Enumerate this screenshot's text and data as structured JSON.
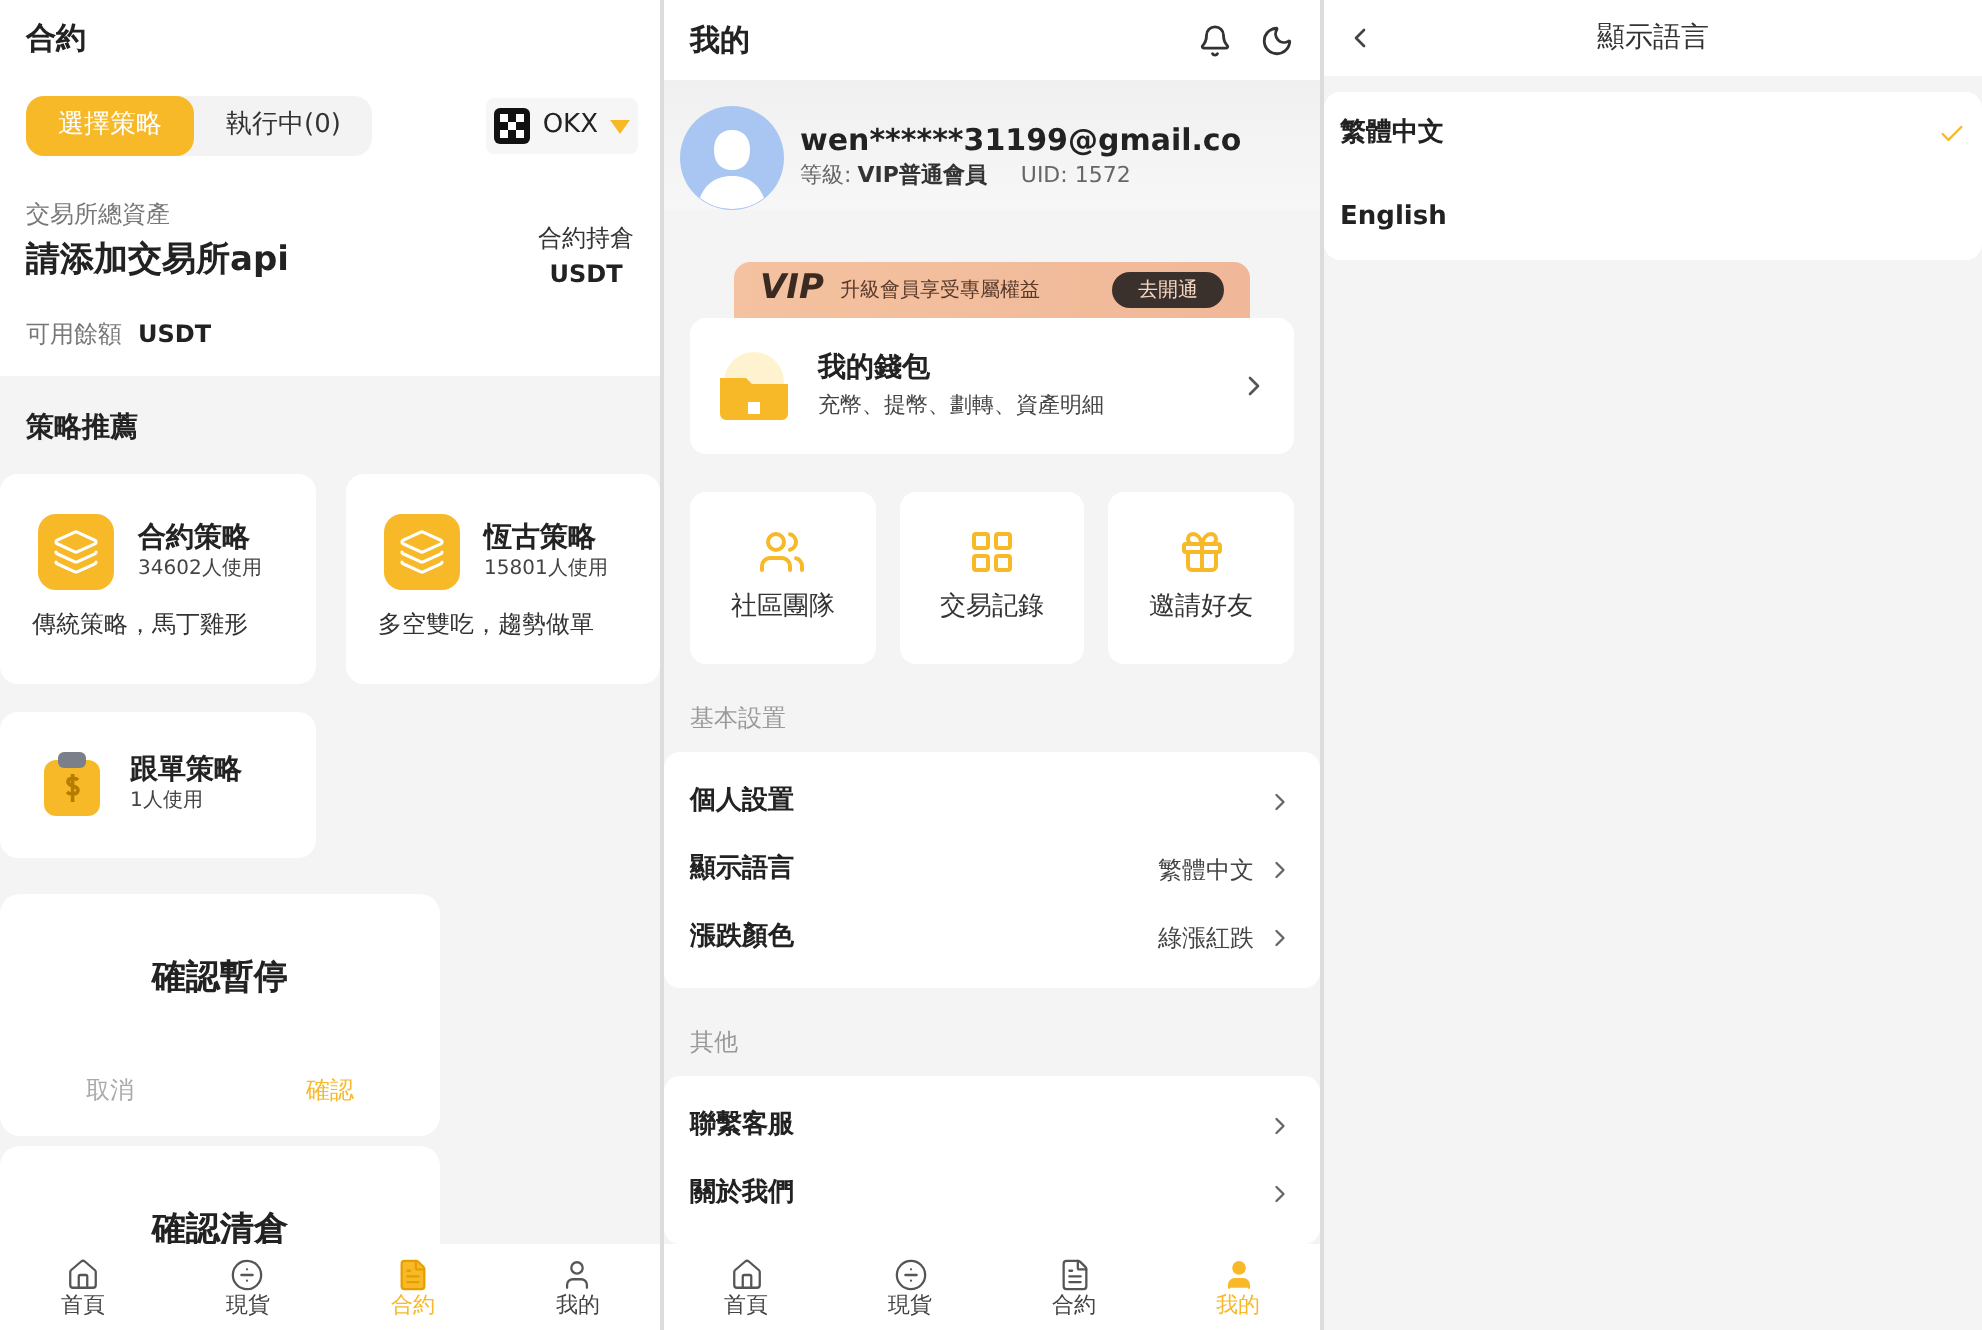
{
  "contract": {
    "title": "合約",
    "tabs": [
      {
        "label": "選擇策略",
        "selected": true
      },
      {
        "label": "執行中(0)",
        "selected": false
      }
    ],
    "exchange": "OKX",
    "total_label": "交易所總資產",
    "api_prompt": "請添加交易所api",
    "position_label": "合約持倉",
    "position_unit": "USDT",
    "balance_label": "可用餘額",
    "balance_unit": "USDT",
    "section": "策略推薦",
    "strategies": [
      {
        "kind": "layers",
        "name": "合約策略",
        "users": "34602人使用",
        "desc": "傳統策略，馬丁雞形"
      },
      {
        "kind": "layers",
        "name": "恆古策略",
        "users": "15801人使用",
        "desc": "多空雙吃，趨勢做單"
      },
      {
        "kind": "copy",
        "name": "跟單策略",
        "users": "1人使用"
      }
    ],
    "dialogs": [
      {
        "title": "確認暫停",
        "cancel": "取消",
        "confirm": "確認"
      },
      {
        "title": "確認清倉"
      }
    ],
    "nav": [
      {
        "kind": "home",
        "label": "首頁",
        "selected": false
      },
      {
        "kind": "spot",
        "label": "現貨",
        "selected": false
      },
      {
        "kind": "contract",
        "label": "合約",
        "selected": true
      },
      {
        "kind": "mine",
        "label": "我的",
        "selected": false
      }
    ]
  },
  "mine": {
    "title": "我的",
    "email": "wen******31199@gmail.co",
    "level_label": "等級:",
    "level": "VIP普通會員",
    "uid": "UID: 1572",
    "vip_logo": "VIP",
    "vip_text": "升級會員享受專屬權益",
    "vip_button": "去開通",
    "wallet_title": "我的錢包",
    "wallet_desc": "充幣、提幣、劃轉、資產明細",
    "tiles": [
      {
        "kind": "team",
        "label": "社區團隊"
      },
      {
        "kind": "records",
        "label": "交易記錄"
      },
      {
        "kind": "invite",
        "label": "邀請好友"
      }
    ],
    "groups": [
      {
        "title": "基本設置",
        "rows": [
          {
            "label": "個人設置"
          },
          {
            "label": "顯示語言",
            "value": "繁體中文"
          },
          {
            "label": "漲跌顏色",
            "value": "綠漲紅跌"
          }
        ]
      },
      {
        "title": "其他",
        "rows": [
          {
            "label": "聯繫客服"
          },
          {
            "label": "關於我們"
          }
        ]
      }
    ],
    "nav": [
      {
        "kind": "home",
        "label": "首頁",
        "selected": false
      },
      {
        "kind": "spot",
        "label": "現貨",
        "selected": false
      },
      {
        "kind": "contract",
        "label": "合約",
        "selected": false
      },
      {
        "kind": "mine",
        "label": "我的",
        "selected": true
      }
    ]
  },
  "language": {
    "title": "顯示語言",
    "options": [
      {
        "label": "繁體中文",
        "selected": true
      },
      {
        "label": "English",
        "selected": false
      }
    ]
  }
}
